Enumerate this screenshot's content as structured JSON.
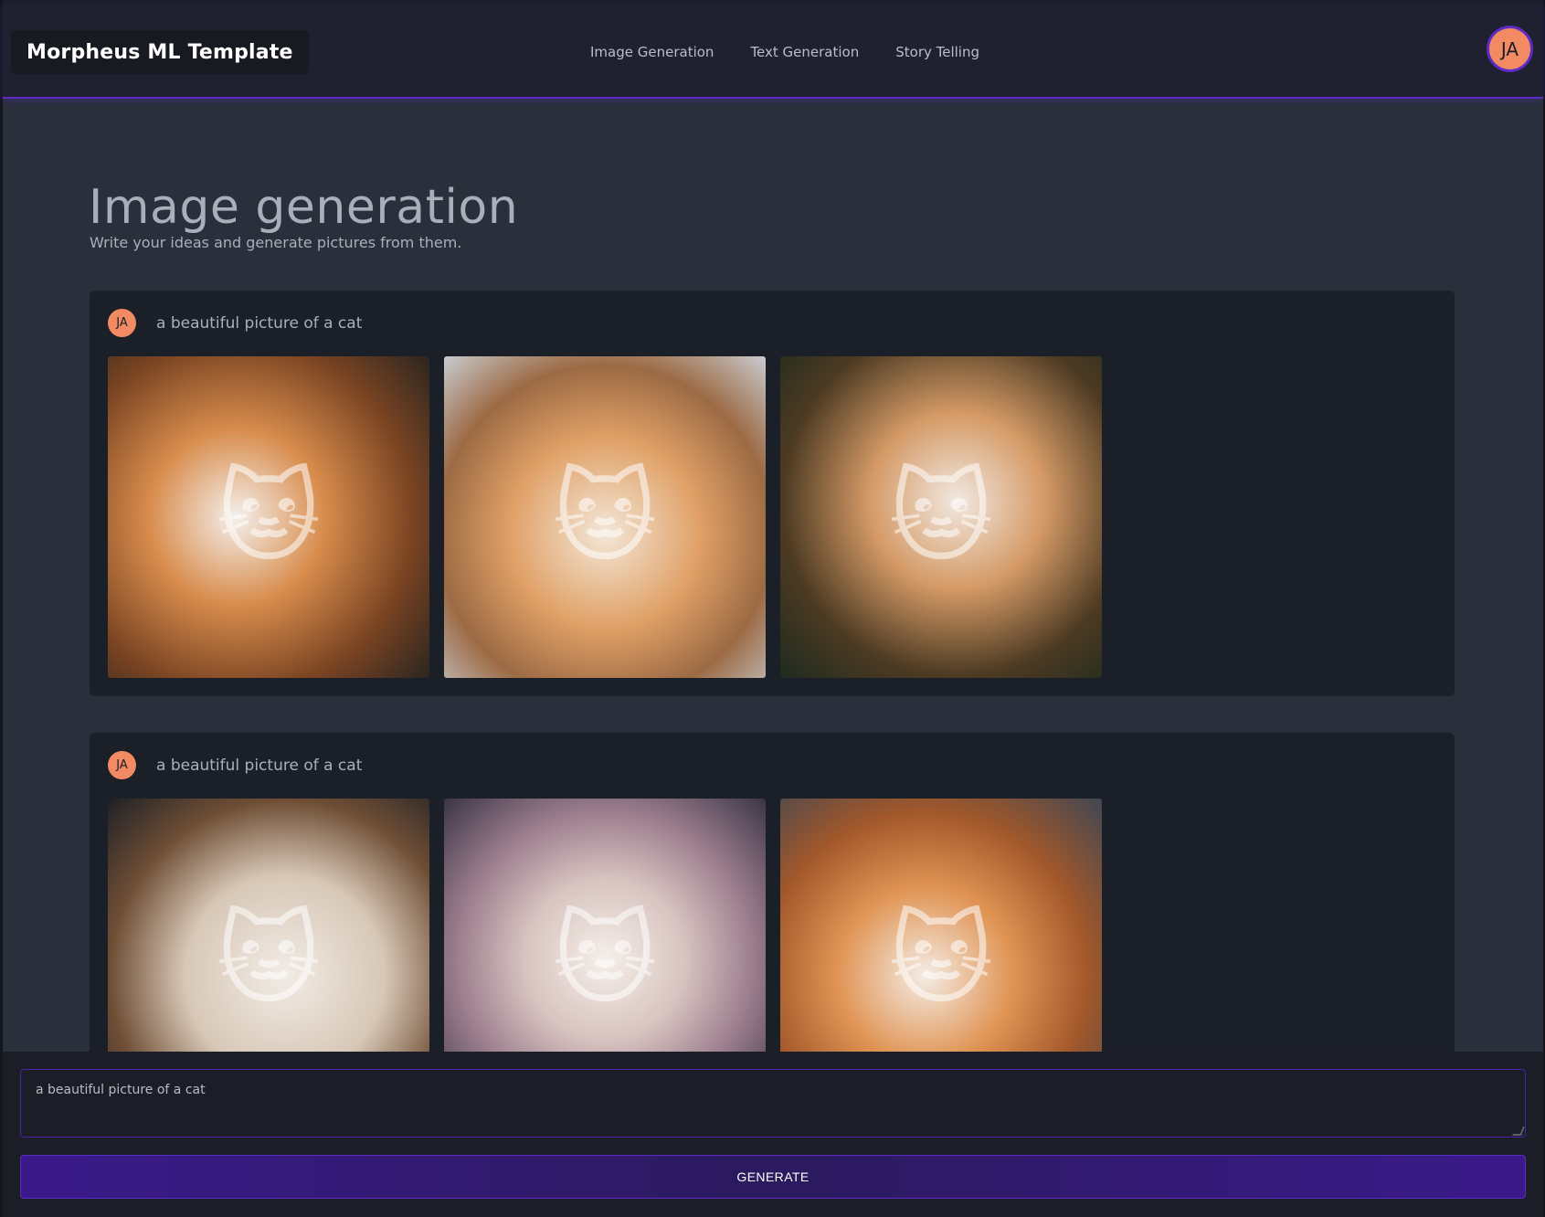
{
  "header": {
    "brand": "Morpheus ML Template",
    "nav": [
      "Image Generation",
      "Text Generation",
      "Story Telling"
    ],
    "avatar_initials": "JA"
  },
  "page": {
    "title": "Image generation",
    "subtitle": "Write your ideas and generate pictures from them."
  },
  "results": [
    {
      "avatar_initials": "JA",
      "prompt": "a beautiful picture of a cat",
      "images": [
        "cat-image-icon",
        "cat-image-icon",
        "cat-image-icon"
      ]
    },
    {
      "avatar_initials": "JA",
      "prompt": "a beautiful picture of a cat",
      "images": [
        "cat-image-icon",
        "cat-image-icon",
        "cat-image-icon"
      ]
    }
  ],
  "composer": {
    "input_value": "a beautiful picture of a cat",
    "generate_label": "GENERATE"
  },
  "colors": {
    "accent": "#5b2bc4",
    "avatar": "#f28a63",
    "background": "#2a303b",
    "card": "#1b1f27"
  }
}
